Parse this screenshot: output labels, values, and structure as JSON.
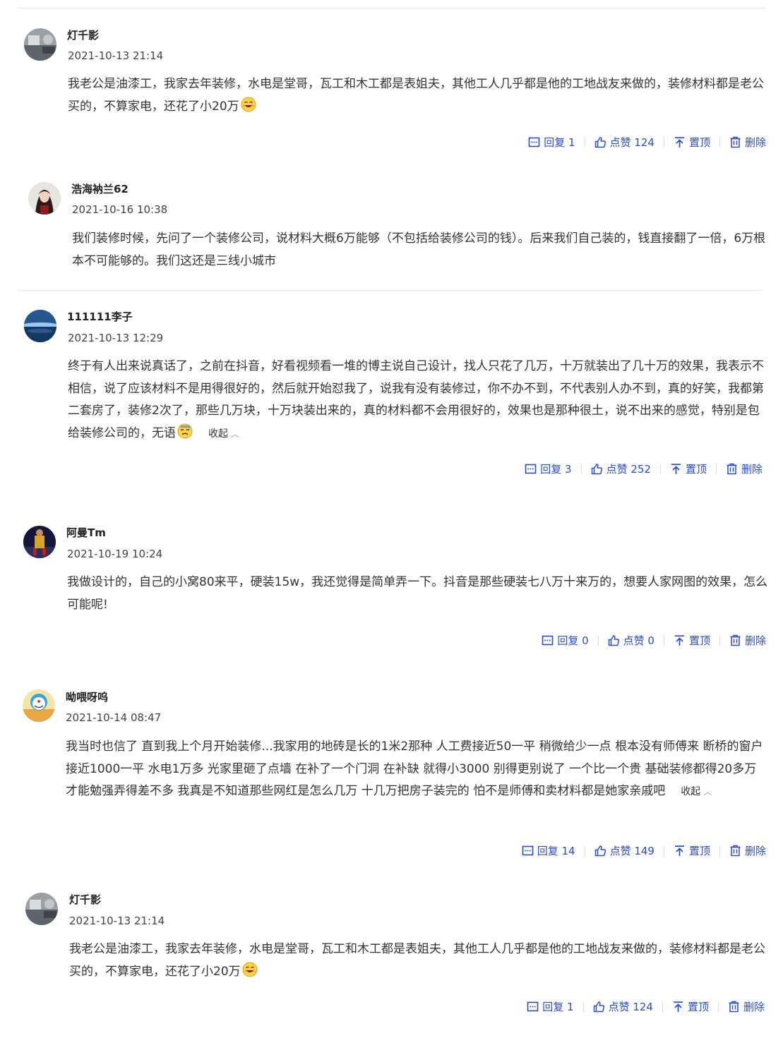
{
  "comments": [
    {
      "username": "灯千影",
      "time": "2021-10-13 21:14",
      "text": "我老公是油漆工，我家去年装修，水电是堂哥，瓦工和木工都是表姐夫，其他工人几乎都是他的工地战友来做的，装修材料都是老公买的，不算家电，还花了小20万",
      "reply_label": "回复 1",
      "like_label": "点赞 124",
      "pin_label": "置顶",
      "delete_label": "删除"
    },
    {
      "username": "浩海衲兰62",
      "time": "2021-10-16 10:38",
      "text": "我们装修时候，先问了一个装修公司，说材料大概6万能够（不包括给装修公司的钱）。后来我们自己装的，钱直接翻了一倍，6万根本不可能够的。我们这还是三线小城市"
    },
    {
      "username": "111111李子",
      "time": "2021-10-13 12:29",
      "text": "终于有人出来说真话了，之前在抖音，好看视频看一堆的博主说自己设计，找人只花了几万，十万就装出了几十万的效果，我表示不相信，说了应该材料不是用得很好的，然后就开始怼我了，说我有没有装修过，你不办不到，不代表别人办不到，真的好笑，我都第二套房了，装修2次了，那些几万块，十万块装出来的，真的材料都不会用很好的，效果也是那种很土，说不出来的感觉，特别是包给装修公司的，无语",
      "collapse_label": "收起",
      "reply_label": "回复 3",
      "like_label": "点赞 252",
      "pin_label": "置顶",
      "delete_label": "删除"
    },
    {
      "username": "阿曼Tm",
      "time": "2021-10-19 10:24",
      "text": "我做设计的，自己的小窝80来平，硬装15w，我还觉得是简单弄一下。抖音是那些硬装七八万十来万的，想要人家网图的效果，怎么可能呢!",
      "reply_label": "回复 0",
      "like_label": "点赞 0",
      "pin_label": "置顶",
      "delete_label": "删除"
    },
    {
      "username": "呦喂呀呜",
      "time": "2021-10-14 08:47",
      "text": "我当时也信了 直到我上个月开始装修...我家用的地砖是长的1米2那种 人工费接近50一平 稍微给少一点 根本没有师傅来 断桥的窗户接近1000一平 水电1万多 光家里砸了点墙 在补了一个门洞 在补缺 就得小3000 别得更别说了 一个比一个贵 基础装修都得20多万 才能勉强弄得差不多 我真是不知道那些网红是怎么几万 十几万把房子装完的 怕不是师傅和卖材料都是她家亲戚吧",
      "collapse_label": "收起",
      "reply_label": "回复 14",
      "like_label": "点赞 149",
      "pin_label": "置顶",
      "delete_label": "删除"
    },
    {
      "username": "灯千影",
      "time": "2021-10-13 21:14",
      "text": "我老公是油漆工，我家去年装修，水电是堂哥，瓦工和木工都是表姐夫，其他工人几乎都是他的工地战友来做的，装修材料都是老公买的，不算家电，还花了小20万",
      "reply_label": "回复 1",
      "like_label": "点赞 124",
      "pin_label": "置顶",
      "delete_label": "删除"
    }
  ],
  "icons": {
    "reply": "reply-icon",
    "like": "thumbs-up-icon",
    "pin": "pin-to-top-icon",
    "delete": "trash-icon",
    "emoji_grin": "grin-emoji-icon",
    "emoji_sweat": "sweat-emoji-icon"
  },
  "colors": {
    "action_blue": "#2a4bd6",
    "text": "#333333",
    "divider": "#e6e6e6"
  }
}
